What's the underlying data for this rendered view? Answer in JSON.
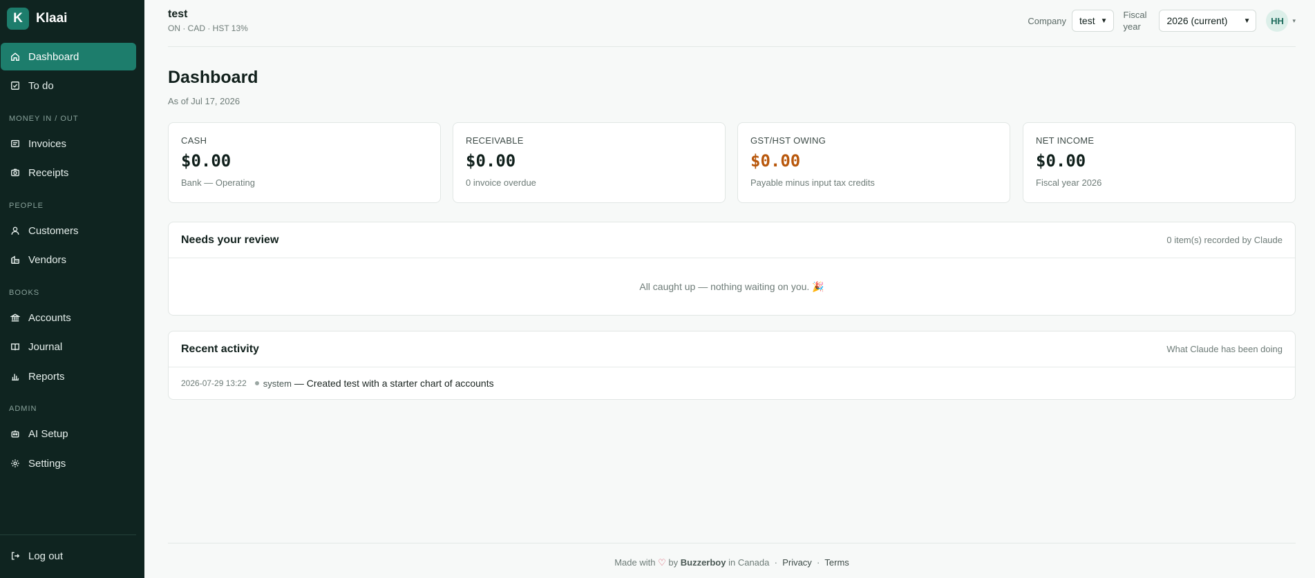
{
  "brand": {
    "logo_letter": "K",
    "name": "Klaai",
    "accent": "#1d7d6c"
  },
  "sidebar": {
    "items": [
      {
        "label": "Dashboard",
        "icon": "home-icon",
        "active": true
      },
      {
        "label": "To do",
        "icon": "checkbox-icon"
      },
      {
        "label": "Invoices",
        "icon": "invoice-icon"
      },
      {
        "label": "Receipts",
        "icon": "camera-icon"
      },
      {
        "label": "Customers",
        "icon": "user-icon"
      },
      {
        "label": "Vendors",
        "icon": "building-icon"
      },
      {
        "label": "Accounts",
        "icon": "bank-icon"
      },
      {
        "label": "Journal",
        "icon": "book-icon"
      },
      {
        "label": "Reports",
        "icon": "bar-chart-icon"
      },
      {
        "label": "AI Setup",
        "icon": "robot-icon"
      },
      {
        "label": "Settings",
        "icon": "gear-icon"
      }
    ],
    "sections": [
      "MONEY IN / OUT",
      "PEOPLE",
      "BOOKS",
      "ADMIN"
    ],
    "logout_label": "Log out"
  },
  "header": {
    "company_name": "test",
    "company_meta": "ON · CAD · HST 13%",
    "company_label": "Company",
    "company_value": "test",
    "fiscal_label_1": "Fiscal",
    "fiscal_label_2": "year",
    "fiscal_value": "2026 (current)",
    "avatar_initials": "HH"
  },
  "main": {
    "title": "Dashboard",
    "subtitle": "As of Jul 17, 2026",
    "cards": [
      {
        "label": "CASH",
        "value": "$0.00",
        "note": "Bank — Operating"
      },
      {
        "label": "RECEIVABLE",
        "value": "$0.00",
        "note": "0 invoice overdue"
      },
      {
        "label": "GST/HST OWING",
        "value": "$0.00",
        "note": "Payable minus input tax credits",
        "value_color": "#b8570b"
      },
      {
        "label": "NET INCOME",
        "value": "$0.00",
        "note": "Fiscal year 2026"
      }
    ],
    "review": {
      "title": "Needs your review",
      "meta": "0 item(s) recorded by Claude",
      "empty": "All caught up — nothing waiting on you. 🎉"
    },
    "activity": {
      "title": "Recent activity",
      "meta": "What Claude has been doing",
      "rows": [
        {
          "time": "2026-07-29 13:22",
          "actor": "system",
          "text": "— Created test with a starter chart of accounts"
        }
      ]
    }
  },
  "footer": {
    "made_with": "Made with",
    "heart": "♡",
    "by": "by",
    "company": "Buzzerboy",
    "in": "in Canada",
    "sep": "·",
    "privacy": "Privacy",
    "terms": "Terms"
  }
}
